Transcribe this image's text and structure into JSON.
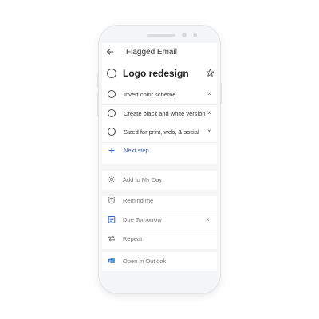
{
  "header": {
    "title": "Flagged Email"
  },
  "task": {
    "title": "Logo redesign"
  },
  "steps": [
    {
      "label": "Invert color scheme"
    },
    {
      "label": "Create black and white version"
    },
    {
      "label": "Sized for print, web, & social"
    }
  ],
  "next_step_label": "Next step",
  "my_day_label": "Add to My Day",
  "options": {
    "remind": "Remind me",
    "due": "Due Tomorrow",
    "repeat": "Repeat"
  },
  "outlook_label": "Open in Outlook",
  "remove_glyph": "×",
  "colors": {
    "accent": "#2f5fd0",
    "text": "#222222",
    "muted": "#777777",
    "outlook": "#1565c0"
  },
  "icons": [
    "back-arrow-icon",
    "circle-icon",
    "star-icon",
    "close-icon",
    "plus-icon",
    "sun-icon",
    "alarm-icon",
    "calendar-icon",
    "repeat-icon",
    "outlook-icon"
  ]
}
